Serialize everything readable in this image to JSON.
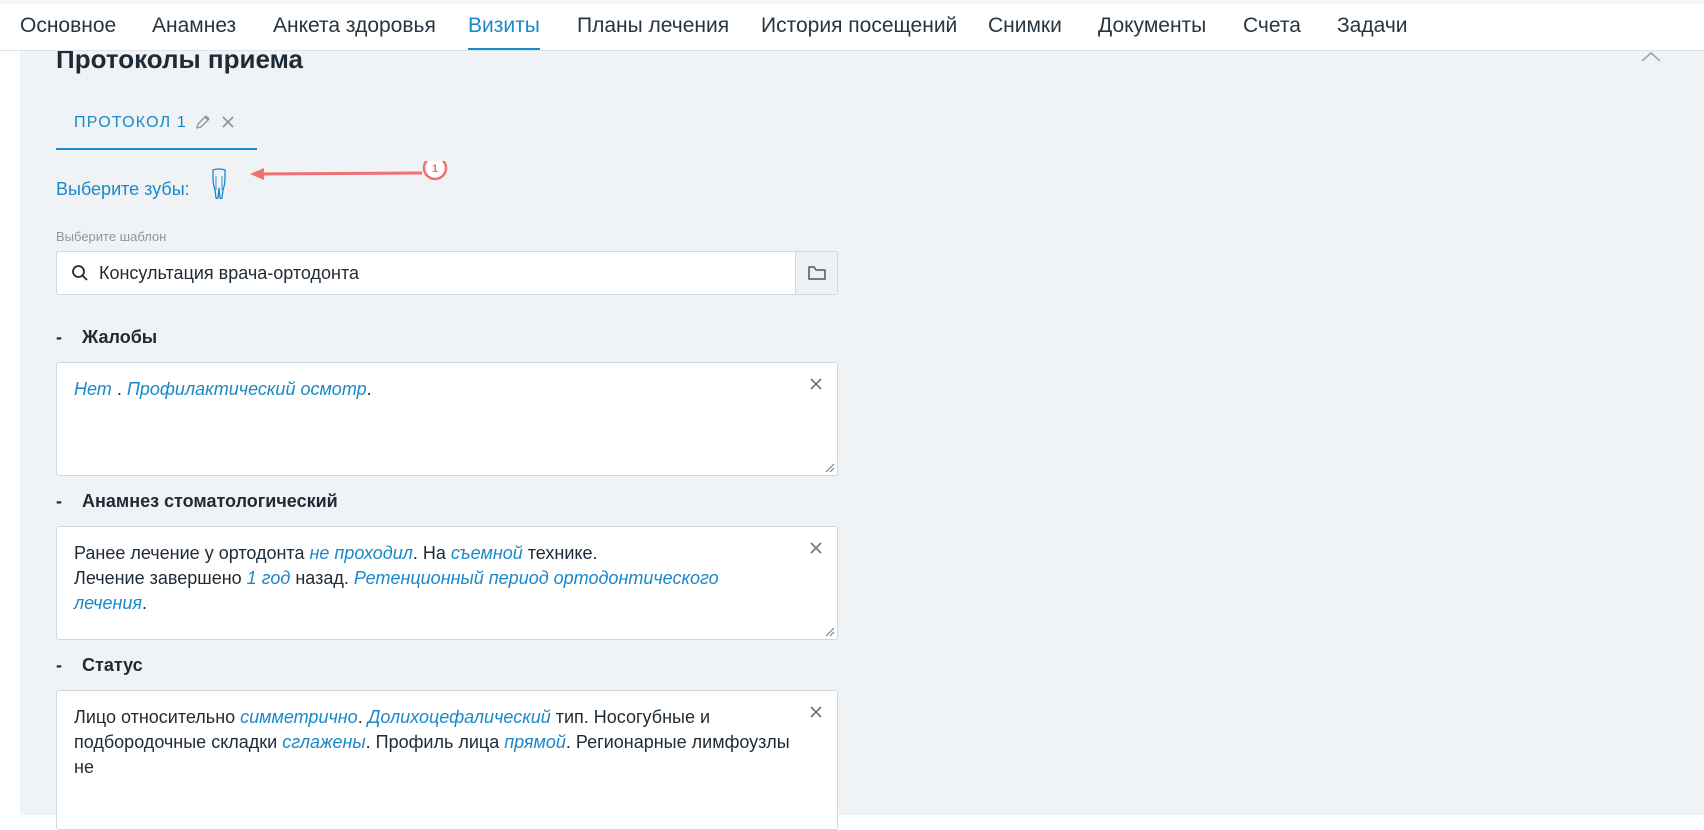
{
  "nav": {
    "tabs": [
      {
        "label": "Основное"
      },
      {
        "label": "Анамнез"
      },
      {
        "label": "Анкета здоровья"
      },
      {
        "label": "Визиты",
        "active": true
      },
      {
        "label": "Планы лечения"
      },
      {
        "label": "История посещений"
      },
      {
        "label": "Снимки"
      },
      {
        "label": "Документы"
      },
      {
        "label": "Счета"
      },
      {
        "label": "Задачи"
      }
    ]
  },
  "panel": {
    "title": "Протоколы приема",
    "protocol_tab": {
      "label": "ПРОТОКОЛ 1"
    },
    "teeth_label": "Выберите зубы:",
    "annotation_number": "1",
    "template": {
      "label": "Выберите шаблон",
      "value": "Консультация врача-ортодонта"
    },
    "sections": [
      {
        "dash": "-",
        "title": "Жалобы",
        "lines": [
          [
            {
              "t": "Нет",
              "v": true
            },
            {
              "t": " . "
            },
            {
              "t": "Профилактический осмотр",
              "v": true
            },
            {
              "t": "."
            }
          ]
        ]
      },
      {
        "dash": "-",
        "title": "Анамнез стоматологический",
        "lines": [
          [
            {
              "t": "Ранее лечение у ортодонта "
            },
            {
              "t": "не проходил",
              "v": true
            },
            {
              "t": ". На "
            },
            {
              "t": "съемной",
              "v": true
            },
            {
              "t": " технике."
            }
          ],
          [
            {
              "t": "Лечение завершено "
            },
            {
              "t": "1 год",
              "v": true
            },
            {
              "t": " назад. "
            },
            {
              "t": "Ретенционный период ортодонтического лечения",
              "v": true
            },
            {
              "t": "."
            }
          ]
        ]
      },
      {
        "dash": "-",
        "title": "Статус",
        "lines": [
          [
            {
              "t": "Лицо относительно "
            },
            {
              "t": "симметрично",
              "v": true
            },
            {
              "t": ". "
            },
            {
              "t": "Долихоцефалический",
              "v": true
            },
            {
              "t": " тип. Носогубные и"
            }
          ],
          [
            {
              "t": "подбородочные складки "
            },
            {
              "t": "сглажены",
              "v": true
            },
            {
              "t": ". Профиль лица "
            },
            {
              "t": "прямой",
              "v": true
            },
            {
              "t": ". Регионарные лимфоузлы не"
            }
          ]
        ]
      }
    ]
  },
  "colors": {
    "accent": "#1a88c9",
    "annotation": "#f07070",
    "panel_bg": "#f0f3f6"
  }
}
